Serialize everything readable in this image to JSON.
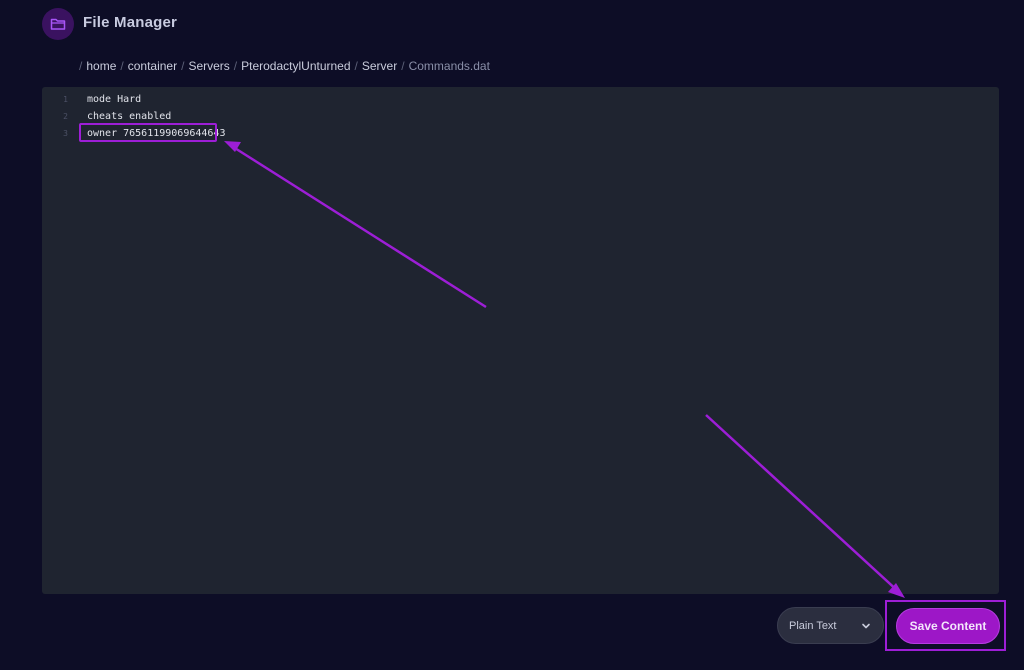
{
  "header": {
    "title": "File Manager",
    "icon": "folder-icon"
  },
  "breadcrumb": {
    "separator": "/",
    "links": [
      "home",
      "container",
      "Servers",
      "PterodactylUnturned",
      "Server"
    ],
    "current": "Commands.dat"
  },
  "editor": {
    "lines": [
      {
        "number": "1",
        "text": "mode Hard"
      },
      {
        "number": "2",
        "text": "cheats enabled"
      },
      {
        "number": "3",
        "text": "owner 76561199069644643"
      }
    ]
  },
  "footer": {
    "mode_select_value": "Plain Text",
    "save_label": "Save Content"
  },
  "colors": {
    "background": "#0d0d26",
    "editor_background": "#1f2430",
    "accent": "#9d17c7",
    "highlight": "#9d1ed6"
  }
}
